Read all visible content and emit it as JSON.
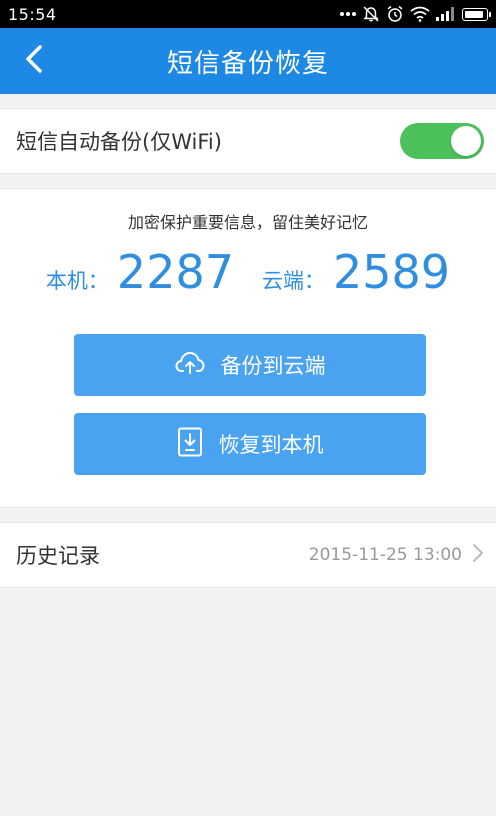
{
  "status_bar": {
    "time": "15:54",
    "icons": [
      "more-dots-icon",
      "alarm-off-icon",
      "alarm-icon",
      "wifi-icon",
      "signal-icon",
      "battery-icon"
    ]
  },
  "app_bar": {
    "title": "短信备份恢复",
    "back_icon": "chevron-left-icon",
    "color": "#1e88e5"
  },
  "auto_backup": {
    "label": "短信自动备份(仅WiFi)",
    "enabled": true,
    "switch_color": "#4cc05b"
  },
  "summary": {
    "tagline": "加密保护重要信息，留住美好记忆",
    "local_label": "本机：",
    "local_count": "2287",
    "cloud_label": "云端：",
    "cloud_count": "2589",
    "accent": "#2f8ee0"
  },
  "actions": {
    "backup_label": "备份到云端",
    "backup_icon": "cloud-upload-icon",
    "restore_label": "恢复到本机",
    "restore_icon": "phone-download-icon",
    "button_color": "#4aa3f0"
  },
  "history": {
    "label": "历史记录",
    "date": "2015-11-25 13:00",
    "icon": "chevron-right-icon"
  }
}
